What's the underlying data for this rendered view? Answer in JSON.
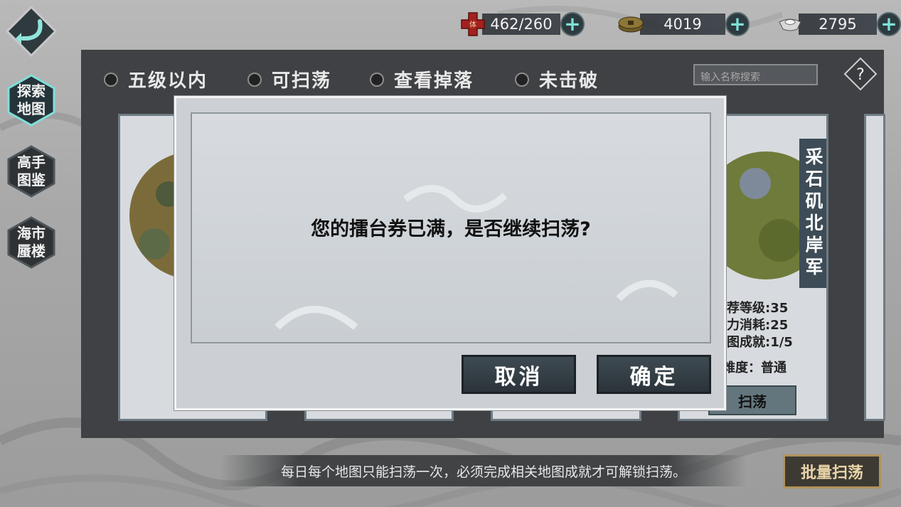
{
  "resources": {
    "stamina": "462/260",
    "stamina_badge": "体",
    "coins": "4019",
    "silver": "2795"
  },
  "side_menu": [
    {
      "label_top": "探索",
      "label_bottom": "地图"
    },
    {
      "label_top": "高手",
      "label_bottom": "图鉴"
    },
    {
      "label_top": "海市",
      "label_bottom": "蜃楼"
    }
  ],
  "filters": [
    "五级以内",
    "可扫荡",
    "查看掉落",
    "未击破"
  ],
  "search": {
    "placeholder": "输入名称搜索"
  },
  "help_label": "?",
  "card": {
    "title": "采石矶北岸军",
    "recommended_level": "荐等级:35",
    "stamina_cost": "力消耗:25",
    "achievement": "图成就:1/5",
    "difficulty": "难度：普通",
    "sweep_label": "扫荡"
  },
  "dialog": {
    "message": "您的擂台券已满，是否继续扫荡?",
    "cancel_label": "取消",
    "confirm_label": "确定"
  },
  "tip": "每日每个地图只能扫荡一次，必须完成相关地图成就才可解锁扫荡。",
  "batch_label": "批量扫荡",
  "colors": {
    "panel": "#3f4144",
    "dialog": "#ccd0d5",
    "accent": "#7fe0d8",
    "batch_border": "#b0925a"
  }
}
